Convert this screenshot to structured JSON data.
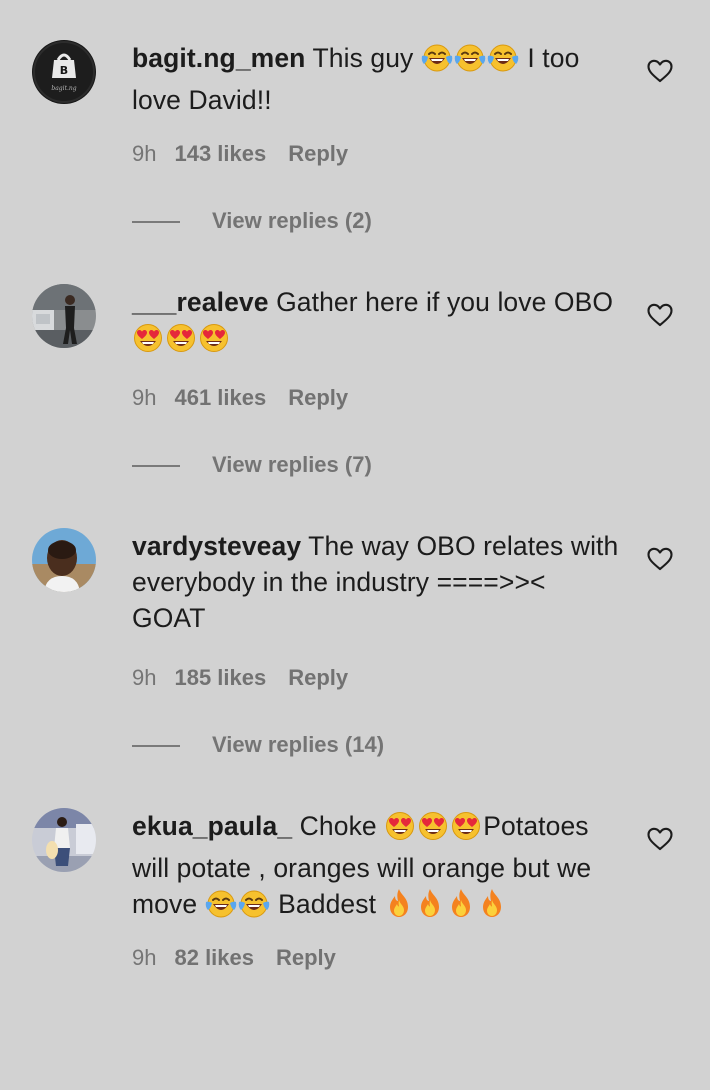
{
  "comments": [
    {
      "username": "bagit.ng_men",
      "parts": [
        {
          "t": "This guy "
        },
        {
          "e": "laugh"
        },
        {
          "e": "laugh"
        },
        {
          "e": "laugh"
        },
        {
          "t": " I too love David!!"
        }
      ],
      "time": "9h",
      "likes": "143 likes",
      "reply": "Reply",
      "view_replies": "View replies (2)",
      "avatar_icon": "brand-logo-avatar"
    },
    {
      "username": "___realeve",
      "parts": [
        {
          "t": "Gather here if you love OBO "
        },
        {
          "e": "hearteyes"
        },
        {
          "e": "hearteyes"
        },
        {
          "e": "hearteyes"
        }
      ],
      "time": "9h",
      "likes": "461 likes",
      "reply": "Reply",
      "view_replies": "View replies (7)",
      "avatar_icon": "person-photo-avatar"
    },
    {
      "username": "vardysteveay",
      "parts": [
        {
          "t": "The way OBO relates with everybody in the industry ====>>< GOAT"
        }
      ],
      "time": "9h",
      "likes": "185 likes",
      "reply": "Reply",
      "view_replies": "View replies (14)",
      "avatar_icon": "person-photo-avatar"
    },
    {
      "username": "ekua_paula_",
      "parts": [
        {
          "t": "Choke "
        },
        {
          "e": "hearteyes"
        },
        {
          "e": "hearteyes"
        },
        {
          "e": "hearteyes"
        },
        {
          "t": "Potatoes will potate , oranges will orange but we move "
        },
        {
          "e": "laugh"
        },
        {
          "e": "laugh"
        },
        {
          "t": " Baddest "
        },
        {
          "e": "fire"
        },
        {
          "e": "fire"
        },
        {
          "e": "fire"
        },
        {
          "e": "fire"
        }
      ],
      "time": "9h",
      "likes": "82 likes",
      "reply": "Reply",
      "view_replies": "",
      "avatar_icon": "person-photo-avatar"
    }
  ],
  "icons": {
    "like": "heart-outline-icon",
    "emoji_laugh": "face-with-tears-of-joy-emoji",
    "emoji_hearteyes": "smiling-face-with-heart-eyes-emoji",
    "emoji_fire": "fire-emoji"
  },
  "colors": {
    "background": "#d2d2d2",
    "text": "#1c1c1c",
    "meta": "#727272"
  }
}
